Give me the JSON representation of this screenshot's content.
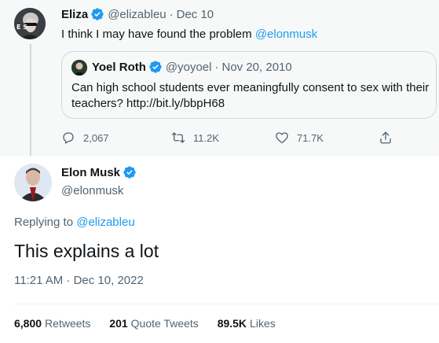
{
  "parent_tweet": {
    "author_name": "Eliza",
    "handle": "@elizableu",
    "separator": "·",
    "date": "Dec 10",
    "text_prefix": "I think I may have found the problem ",
    "mention": "@elonmusk",
    "avatar_text": "E S"
  },
  "quoted_tweet": {
    "author_name": "Yoel Roth",
    "handle": "@yoyoel",
    "separator": "·",
    "date": "Nov 20, 2010",
    "text_line1": "Can high school students ever meaningfully consent to sex with their",
    "text_line2": "teachers? http://bit.ly/bbpH68"
  },
  "parent_actions": {
    "replies": "2,067",
    "retweets": "11.2K",
    "likes": "71.7K"
  },
  "main_tweet": {
    "author_name": "Elon Musk",
    "handle": "@elonmusk",
    "replying_prefix": "Replying to ",
    "replying_to": "@elizableu",
    "text": "This explains a lot",
    "timestamp": "11:21 AM · Dec 10, 2022"
  },
  "stats": {
    "retweets_count": "6,800",
    "retweets_label": "Retweets",
    "quotes_count": "201",
    "quotes_label": "Quote Tweets",
    "likes_count": "89.5K",
    "likes_label": "Likes"
  },
  "colors": {
    "accent": "#1d9bf0",
    "muted_text": "#536471",
    "thread_background": "#f7f9f9"
  },
  "icons": [
    "verified-badge-icon",
    "reply-icon",
    "retweet-icon",
    "like-icon",
    "share-icon"
  ]
}
